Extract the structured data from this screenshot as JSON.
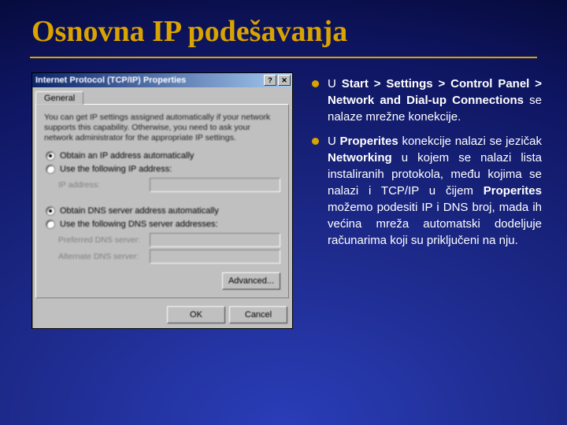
{
  "slide": {
    "title": "Osnovna IP podešavanja"
  },
  "dialog": {
    "title": "Internet Protocol (TCP/IP) Properties",
    "tab": "General",
    "description": "You can get IP settings assigned automatically if your network supports this capability. Otherwise, you need to ask your network administrator for the appropriate IP settings.",
    "radio_obtain_ip": "Obtain an IP address automatically",
    "radio_use_ip": "Use the following IP address:",
    "label_ip": "IP address:",
    "radio_obtain_dns": "Obtain DNS server address automatically",
    "radio_use_dns": "Use the following DNS server addresses:",
    "label_pref_dns": "Preferred DNS server:",
    "label_alt_dns": "Alternate DNS server:",
    "btn_advanced": "Advanced...",
    "btn_ok": "OK",
    "btn_cancel": "Cancel"
  },
  "bullets": {
    "item1_html": "U <b>Start > Settings > Control Panel > Network and Dial-up Connections</b> se nalaze mrežne konekcije.",
    "item2_html": "U <b>Properites</b> konekcije nalazi se jezičak <b>Networking</b> u kojem se nalazi lista instaliranih protokola, među kojima se nalazi i TCP/IP u čijem <b>Properites</b> možemo podesiti IP i DNS broj, mada ih većina mreža automatski dodeljuje računarima koji su priključeni na nju."
  }
}
